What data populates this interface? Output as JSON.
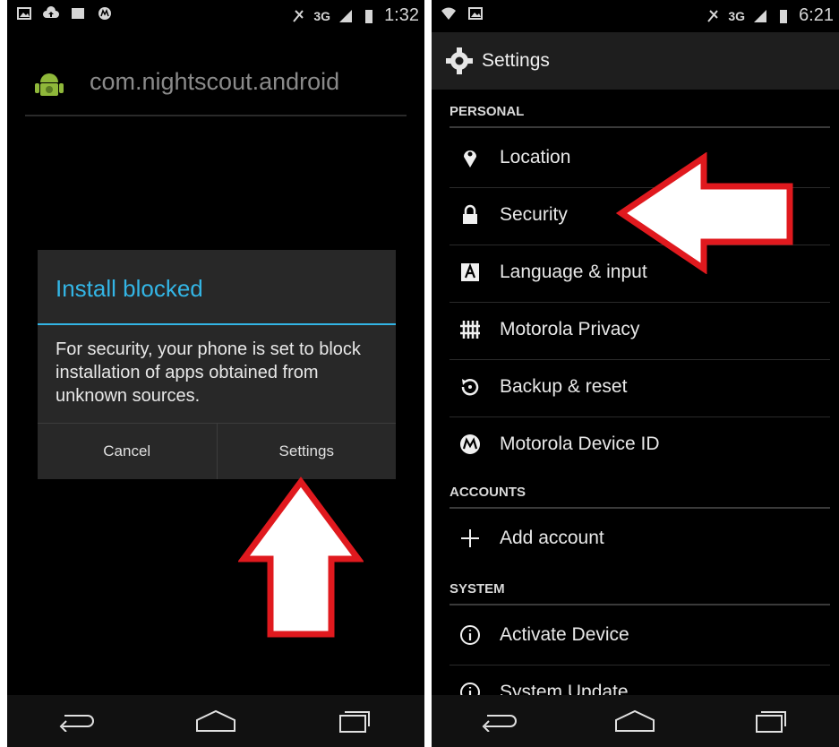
{
  "left_screen": {
    "status_time": "1:32",
    "network": "3G",
    "app_title": "com.nightscout.android",
    "dialog": {
      "title": "Install blocked",
      "message": "For security, your phone is set to block installation of apps obtained from unknown sources.",
      "cancel_label": "Cancel",
      "settings_label": "Settings"
    }
  },
  "right_screen": {
    "status_time": "6:21",
    "network": "3G",
    "title": "Settings",
    "sections": {
      "personal": "PERSONAL",
      "accounts": "ACCOUNTS",
      "system": "SYSTEM"
    },
    "items": {
      "location": "Location",
      "security": "Security",
      "language": "Language & input",
      "privacy": "Motorola Privacy",
      "backup": "Backup & reset",
      "device_id": "Motorola Device ID",
      "add_account": "Add account",
      "activate": "Activate Device",
      "system_update": "System Update"
    }
  },
  "colors": {
    "dialog_accent": "#33b5e5",
    "arrow_outline": "#e0191e",
    "arrow_fill": "#ffffff"
  }
}
